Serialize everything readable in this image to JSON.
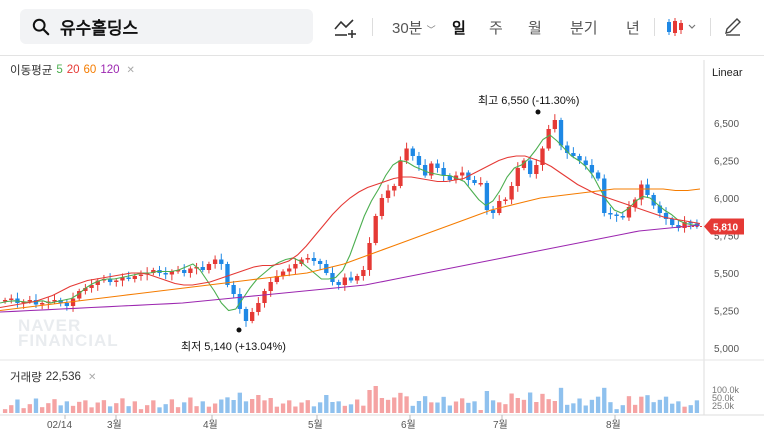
{
  "search": {
    "query": "유수홀딩스"
  },
  "toolbar": {
    "periods": [
      {
        "label": "30분",
        "has_dropdown": true,
        "active": false
      },
      {
        "label": "일",
        "active": true
      },
      {
        "label": "주",
        "active": false
      },
      {
        "label": "월",
        "active": false
      },
      {
        "label": "분기",
        "active": false
      },
      {
        "label": "년",
        "active": false
      }
    ],
    "icons": [
      "drawing-tool-icon",
      "candlestick-type-icon",
      "chevron-down-icon",
      "pencil-icon"
    ]
  },
  "legend": {
    "label": "이동평균",
    "periods": [
      "5",
      "20",
      "60",
      "120"
    ]
  },
  "scale_mode": "Linear",
  "watermark": [
    "NAVER",
    "FINANCIAL"
  ],
  "volume": {
    "label": "거래량",
    "value": "22,536",
    "axis_labels": [
      "100.0k",
      "50.0k",
      "25.0k"
    ]
  },
  "annotations": {
    "high": "최고 6,550 (-11.30%)",
    "low": "최저 5,140 (+13.04%)"
  },
  "current_price": "5,810",
  "colors": {
    "up": "#e53935",
    "down": "#1e88e5",
    "ma5": "#4caf50",
    "ma20": "#e53935",
    "ma60": "#f57c00",
    "ma120": "#9c27b0"
  },
  "chart_data": {
    "type": "candlestick",
    "y_axis": {
      "min": 5000,
      "max": 6500,
      "ticks": [
        "6,500",
        "6,250",
        "6,000",
        "5,750",
        "5,500",
        "5,250",
        "5,000"
      ]
    },
    "x_axis": {
      "labels": [
        "02/14",
        "3월",
        "4월",
        "5월",
        "6월",
        "7월",
        "8월"
      ]
    },
    "high": 6550,
    "low": 5140,
    "last": 5810,
    "close_series": [
      5320,
      5330,
      5300,
      5310,
      5320,
      5290,
      5300,
      5310,
      5320,
      5300,
      5280,
      5330,
      5380,
      5400,
      5420,
      5450,
      5460,
      5440,
      5450,
      5470,
      5460,
      5480,
      5490,
      5500,
      5520,
      5500,
      5490,
      5510,
      5520,
      5500,
      5530,
      5540,
      5520,
      5560,
      5590,
      5560,
      5420,
      5360,
      5260,
      5180,
      5240,
      5300,
      5380,
      5440,
      5480,
      5510,
      5530,
      5560,
      5590,
      5600,
      5580,
      5560,
      5500,
      5440,
      5420,
      5470,
      5450,
      5480,
      5520,
      5700,
      5880,
      6000,
      6050,
      6080,
      6250,
      6330,
      6280,
      6220,
      6150,
      6230,
      6200,
      6150,
      6120,
      6150,
      6170,
      6120,
      6100,
      6100,
      5920,
      5900,
      5980,
      5990,
      6080,
      6200,
      6250,
      6160,
      6220,
      6330,
      6460,
      6520,
      6350,
      6300,
      6280,
      6250,
      6220,
      6170,
      6130,
      5900,
      5890,
      5880,
      5870,
      5940,
      5990,
      6090,
      6020,
      5950,
      5900,
      5860,
      5820,
      5800,
      5840,
      5830,
      5810
    ],
    "ma_series": [
      {
        "name": "5",
        "values": [
          5300,
          5310,
          5315,
          5310,
          5305,
          5310,
          5315,
          5300,
          5310,
          5320,
          5330,
          5360,
          5400,
          5430,
          5450,
          5460,
          5460,
          5470,
          5480,
          5490,
          5500,
          5500,
          5510,
          5510,
          5510,
          5520,
          5540,
          5560,
          5520,
          5450,
          5380,
          5300,
          5250,
          5260,
          5330,
          5400,
          5460,
          5500,
          5540,
          5570,
          5590,
          5600,
          5580,
          5540,
          5500,
          5460,
          5460,
          5470,
          5520,
          5620,
          5750,
          5880,
          5980,
          6060,
          6150,
          6220,
          6250,
          6240,
          6210,
          6190,
          6170,
          6160,
          6150,
          6150,
          6130,
          6110,
          6050,
          5990,
          5950,
          5980,
          6050,
          6140,
          6200,
          6220,
          6260,
          6320,
          6390,
          6420,
          6380,
          6330,
          6280,
          6250,
          6210,
          6150,
          6060,
          5980,
          5920,
          5900,
          5930,
          5980,
          6010,
          6000,
          5960,
          5920,
          5890,
          5850,
          5830,
          5820,
          5820
        ]
      },
      {
        "name": "20",
        "values": [
          5270,
          5280,
          5290,
          5300,
          5310,
          5330,
          5350,
          5380,
          5410,
          5430,
          5450,
          5460,
          5470,
          5480,
          5490,
          5500,
          5500,
          5490,
          5470,
          5450,
          5430,
          5420,
          5420,
          5430,
          5440,
          5460,
          5480,
          5500,
          5520,
          5540,
          5550,
          5550,
          5560,
          5580,
          5620,
          5680,
          5750,
          5820,
          5890,
          5950,
          6000,
          6040,
          6070,
          6090,
          6110,
          6130,
          6140,
          6140,
          6130,
          6120,
          6110,
          6110,
          6120,
          6130,
          6160,
          6190,
          6220,
          6250,
          6270,
          6280,
          6280,
          6260,
          6240,
          6210,
          6170,
          6130,
          6090,
          6060,
          6030,
          6010,
          5990,
          5970,
          5950,
          5930,
          5910,
          5890,
          5870,
          5860,
          5850,
          5840,
          5830
        ]
      },
      {
        "name": "60",
        "values": [
          5250,
          5260,
          5270,
          5280,
          5290,
          5300,
          5310,
          5320,
          5330,
          5340,
          5350,
          5360,
          5370,
          5380,
          5390,
          5400,
          5410,
          5420,
          5430,
          5440,
          5450,
          5460,
          5470,
          5480,
          5490,
          5500,
          5520,
          5540,
          5560,
          5590,
          5620,
          5650,
          5680,
          5710,
          5740,
          5770,
          5800,
          5830,
          5860,
          5890,
          5920,
          5940,
          5960,
          5980,
          6000,
          6010,
          6020,
          6030,
          6040,
          6050,
          6060,
          6060,
          6060,
          6060,
          6060,
          6050,
          6050,
          6060
        ]
      },
      {
        "name": "120",
        "values": [
          5240,
          5245,
          5250,
          5255,
          5260,
          5265,
          5270,
          5275,
          5280,
          5285,
          5290,
          5295,
          5300,
          5310,
          5320,
          5330,
          5340,
          5350,
          5360,
          5370,
          5380,
          5390,
          5400,
          5410,
          5420,
          5440,
          5460,
          5480,
          5500,
          5520,
          5540,
          5560,
          5580,
          5600,
          5620,
          5640,
          5660,
          5680,
          5700,
          5720,
          5740,
          5760,
          5780,
          5790,
          5800,
          5810,
          5820
        ]
      }
    ]
  }
}
